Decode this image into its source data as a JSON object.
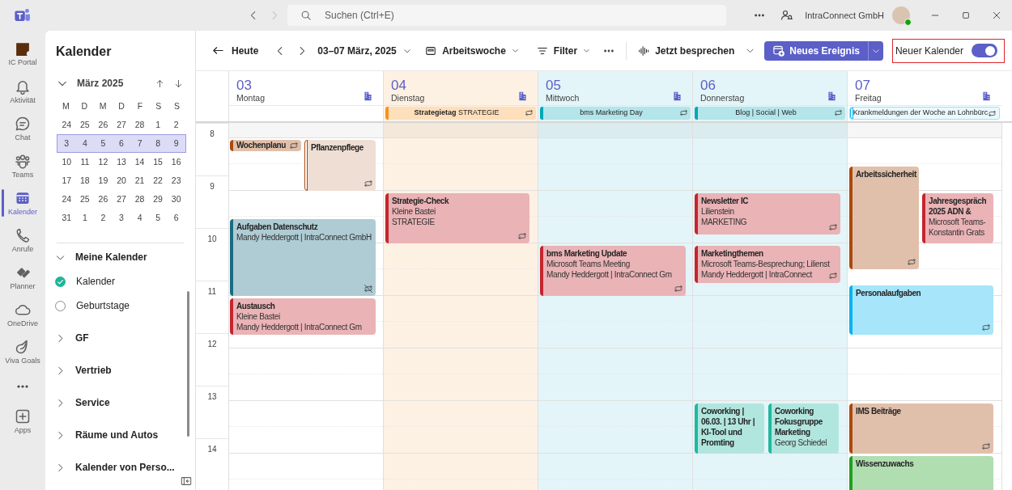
{
  "title_bar": {
    "search": {
      "placeholder": "Suchen (Ctrl+E)"
    },
    "account_name": "IntraConnect GmbH"
  },
  "app_rail": [
    {
      "label": "IC Portal",
      "selected": false
    },
    {
      "label": "Aktivität",
      "selected": false
    },
    {
      "label": "Chat",
      "selected": false
    },
    {
      "label": "Teams",
      "selected": false
    },
    {
      "label": "Kalender",
      "selected": true
    },
    {
      "label": "Anrufe",
      "selected": false
    },
    {
      "label": "Planner",
      "selected": false
    },
    {
      "label": "OneDrive",
      "selected": false
    },
    {
      "label": "Viva Goals",
      "selected": false
    },
    {
      "label": "Apps",
      "selected": false
    }
  ],
  "side_panel": {
    "title": "Kalender",
    "mini_calendar": {
      "month": "März 2025",
      "weekdays": [
        "M",
        "D",
        "M",
        "D",
        "F",
        "S",
        "S"
      ],
      "weeks": [
        {
          "days": [
            "24",
            "25",
            "26",
            "27",
            "28",
            "1",
            "2"
          ],
          "selected": false
        },
        {
          "days": [
            "3",
            "4",
            "5",
            "6",
            "7",
            "8",
            "9"
          ],
          "selected": true
        },
        {
          "days": [
            "10",
            "11",
            "12",
            "13",
            "14",
            "15",
            "16"
          ],
          "selected": false
        },
        {
          "days": [
            "17",
            "18",
            "19",
            "20",
            "21",
            "22",
            "23"
          ],
          "selected": false
        },
        {
          "days": [
            "24",
            "25",
            "26",
            "27",
            "28",
            "29",
            "30"
          ],
          "selected": false
        },
        {
          "days": [
            "31",
            "1",
            "2",
            "3",
            "4",
            "5",
            "6"
          ],
          "selected": false
        }
      ]
    },
    "calendar_groups": [
      {
        "label": "Meine Kalender",
        "expanded": true,
        "children": [
          {
            "label": "Kalender",
            "checked": true
          },
          {
            "label": "Geburtstage",
            "checked": false
          }
        ]
      },
      {
        "label": "GF",
        "expanded": false
      },
      {
        "label": "Vertrieb",
        "expanded": false
      },
      {
        "label": "Service",
        "expanded": false
      },
      {
        "label": "Räume und Autos",
        "expanded": false
      },
      {
        "label": "Kalender von Perso...",
        "expanded": false
      }
    ]
  },
  "toolbar": {
    "today": "Heute",
    "date_range": "03–07 März, 2025",
    "view": "Arbeitswoche",
    "filter": "Filter",
    "talk": "Jetzt besprechen",
    "new_event": "Neues Ereignis",
    "new_calendar": {
      "label": "Neuer Kalender",
      "on": true,
      "highlighted": true
    }
  },
  "hours": [
    "8",
    "9",
    "10",
    "11",
    "12",
    "13",
    "14"
  ],
  "days": [
    {
      "number": "03",
      "name": "Montag",
      "color": "#ffffff",
      "events": [
        {
          "title": "Wochenplanu",
          "color": "#a84a10",
          "tentative": false,
          "recurring": true,
          "exception": false
        },
        {
          "title": "Pflanzenpflege",
          "color": "#a84a10",
          "tentative": true,
          "recurring": true,
          "exception": false
        },
        {
          "title": "Aufgaben Datenschutz",
          "lines": [
            "Mandy Heddergott | IntraConnect GmbH"
          ],
          "color": "#1a6b80",
          "tentative": false,
          "recurring": true,
          "exception": true
        },
        {
          "title": "Austausch",
          "lines": [
            "Kleine Bastei",
            "Mandy Heddergott | IntraConnect Gm"
          ],
          "color": "#c4262e",
          "tentative": false,
          "recurring": false
        }
      ]
    },
    {
      "number": "04",
      "name": "Dienstag",
      "color": "#fdf1e4",
      "all_day": [
        {
          "title": "**Strategietag** STRATEGIE",
          "color": "#f7931e",
          "tentative": false
        }
      ],
      "events": [
        {
          "title": "Strategie-Check",
          "lines": [
            "Kleine Bastei",
            "STRATEGIE"
          ],
          "color": "#c4262e",
          "tentative": false,
          "recurring": true,
          "exception": false
        }
      ]
    },
    {
      "number": "05",
      "name": "Mittwoch",
      "color": "#e3f5f8",
      "all_day": [
        {
          "title": "bms Marketing Day",
          "color": "#00a8b8",
          "tentative": false
        }
      ],
      "events": [
        {
          "title": "bms Marketing Update",
          "lines": [
            "Microsoft Teams Meeting",
            "Mandy Heddergott | IntraConnect Gm"
          ],
          "color": "#c4262e",
          "tentative": false,
          "recurring": true,
          "exception": false
        }
      ]
    },
    {
      "number": "06",
      "name": "Donnerstag",
      "color": "#e3f5f8",
      "all_day": [
        {
          "title": "Blog | Social | Web",
          "color": "#00a8b8",
          "tentative": false
        }
      ],
      "events": [
        {
          "title": "Newsletter IC",
          "lines": [
            "Lilienstein",
            "MARKETING"
          ],
          "color": "#c4262e",
          "tentative": false,
          "recurring": true,
          "exception": false
        },
        {
          "title": "Marketingthemen",
          "lines": [
            "Microsoft Teams-Besprechung; Lilienst",
            "Mandy Heddergott | IntraConnect"
          ],
          "color": "#c4262e",
          "tentative": false,
          "recurring": true,
          "exception": false
        },
        {
          "title": "Coworking | 06.03. | 13 Uhr | KI-Tool und Promting",
          "color": "#20b8a0",
          "tentative": false,
          "recurring": false
        },
        {
          "title": "Coworking Fokusgruppe Marketing",
          "lines": [
            "Georg Schiedel"
          ],
          "color": "#20b8a0",
          "tentative": false,
          "recurring": false
        }
      ]
    },
    {
      "number": "07",
      "name": "Freitag",
      "color": "#ffffff",
      "all_day": [
        {
          "title": "Krankmeldungen der Woche an Lohnbürc",
          "color": "#00b4f0",
          "tentative": true
        }
      ],
      "events": [
        {
          "title": "Arbeitssicherheit",
          "color": "#a84a10",
          "tentative": false,
          "recurring": true,
          "exception": false
        },
        {
          "title": "Jahresgespräch 2025 ADN &",
          "lines": [
            "Microsoft Teams-",
            "Konstantin Grats"
          ],
          "color": "#c4262e",
          "tentative": false,
          "recurring": false
        },
        {
          "title": "Personalaufgaben",
          "color": "#00b4f0",
          "tentative": false,
          "recurring": true,
          "exception": false
        },
        {
          "title": "IMS Beiträge",
          "color": "#a84a10",
          "tentative": false,
          "recurring": true,
          "exception": false
        },
        {
          "title": "Wissenzuwachs",
          "color": "#20a020",
          "tentative": false
        }
      ]
    }
  ]
}
